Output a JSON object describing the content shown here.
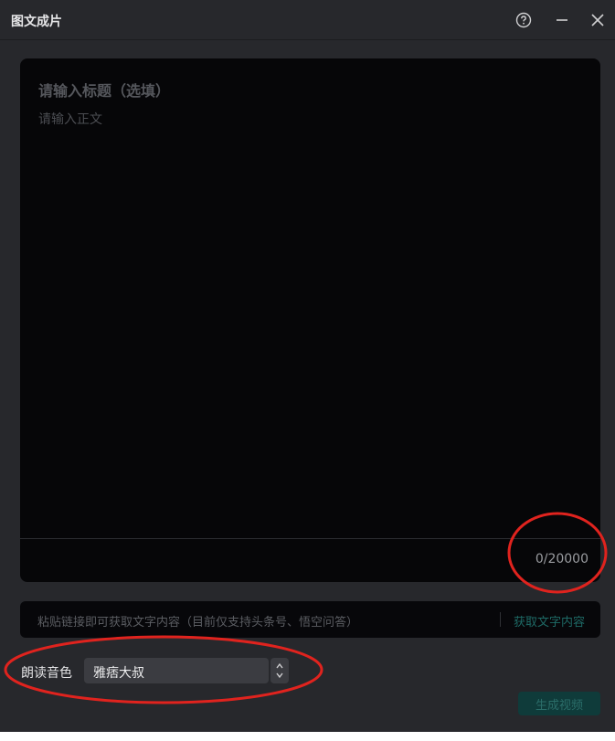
{
  "window": {
    "title": "图文成片",
    "icons": {
      "help": "help-circle-icon",
      "minimize": "minimize-icon",
      "close": "close-icon"
    }
  },
  "editor": {
    "title_placeholder": "请输入标题（选填）",
    "body_placeholder": "请输入正文",
    "counter": "0/20000"
  },
  "link_bar": {
    "placeholder": "粘贴链接即可获取文字内容（目前仅支持头条号、悟空问答）",
    "fetch_label": "获取文字内容"
  },
  "voice": {
    "label": "朗读音色",
    "selected": "雅痞大叔"
  },
  "actions": {
    "generate_label": "生成视频"
  },
  "colors": {
    "background": "#27282c",
    "editor_bg": "#060608",
    "accent_teal": "#1e6a66",
    "annotation_red": "#e0231e"
  }
}
